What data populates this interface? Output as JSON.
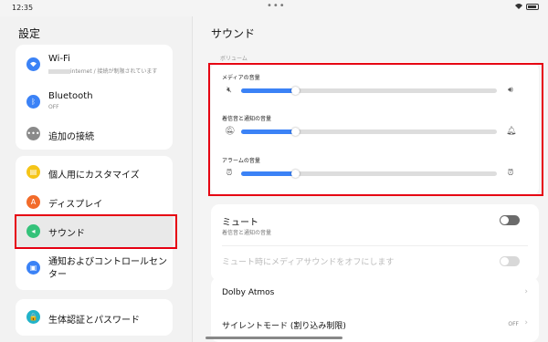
{
  "status": {
    "time": "12:35",
    "dots": "•••"
  },
  "left": {
    "title": "設定",
    "wifi": {
      "label": "Wi-Fi",
      "sub": "internet / 接続が制限されています"
    },
    "bluetooth": {
      "label": "Bluetooth",
      "sub": "OFF"
    },
    "more_connections": {
      "label": "追加の接続"
    },
    "personalize": {
      "label": "個人用にカスタマイズ"
    },
    "display": {
      "label": "ディスプレイ"
    },
    "sound": {
      "label": "サウンド"
    },
    "notifications": {
      "label": "通知およびコントロールセンター"
    },
    "biometrics": {
      "label": "生体認証とパスワード"
    }
  },
  "right": {
    "title": "サウンド",
    "section_label": "ボリューム",
    "volumes": [
      {
        "label": "メディアの音量",
        "value": 0.21
      },
      {
        "label": "着信音と通知の音量",
        "value": 0.21
      },
      {
        "label": "アラームの音量",
        "value": 0.21
      }
    ],
    "mute": {
      "title": "ミュート",
      "sub": "着信音と通知の音量",
      "on": false
    },
    "mute_media": {
      "label": "ミュート時にメディアサウンドをオフにします",
      "on": false,
      "enabled": false
    },
    "dolby": {
      "label": "Dolby Atmos"
    },
    "silent_mode": {
      "label": "サイレントモード (割り込み制限)",
      "value": "OFF"
    }
  },
  "colors": {
    "accent": "#3b82f6",
    "highlight": "#e60012"
  }
}
